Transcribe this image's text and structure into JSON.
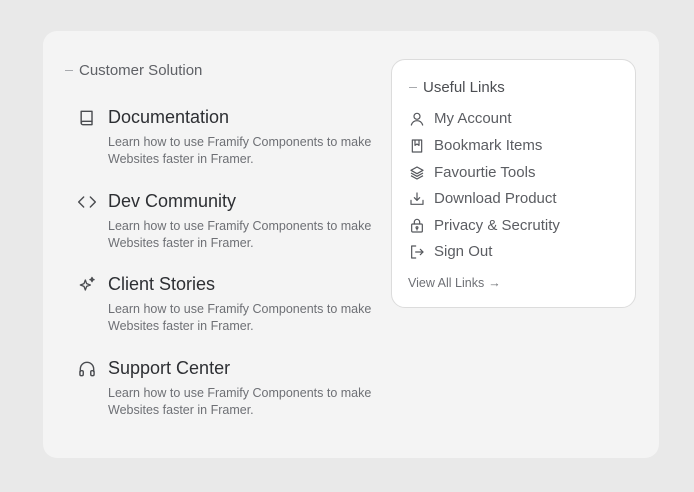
{
  "customer_solution": {
    "label": "Customer Solution",
    "items": [
      {
        "icon": "book-icon",
        "title": "Documentation",
        "desc": "Learn how to use Framify Components to make Websites faster in Framer."
      },
      {
        "icon": "code-icon",
        "title": "Dev Community",
        "desc": "Learn how to use Framify Components to make Websites faster in Framer."
      },
      {
        "icon": "sparkles-icon",
        "title": "Client Stories",
        "desc": "Learn how to use Framify Components to make Websites faster in Framer."
      },
      {
        "icon": "headphones-icon",
        "title": "Support Center",
        "desc": "Learn how to use Framify Components to make Websites faster in Framer."
      }
    ]
  },
  "useful_links": {
    "label": "Useful Links",
    "links": [
      {
        "icon": "user-icon",
        "label": "My Account"
      },
      {
        "icon": "bookmark-icon",
        "label": "Bookmark Items"
      },
      {
        "icon": "layers-icon",
        "label": "Favourtie Tools"
      },
      {
        "icon": "download-icon",
        "label": "Download Product"
      },
      {
        "icon": "lock-icon",
        "label": "Privacy & Secrutity"
      },
      {
        "icon": "sign-out-icon",
        "label": "Sign Out"
      }
    ],
    "view_all": "View All Links",
    "view_all_arrow": "→"
  },
  "colors": {
    "page_bg": "#e9e9e9",
    "panel_bg": "#f4f4f4",
    "card_bg": "#ffffff",
    "title_text": "#2d2f33",
    "body_text": "#6e7075"
  }
}
